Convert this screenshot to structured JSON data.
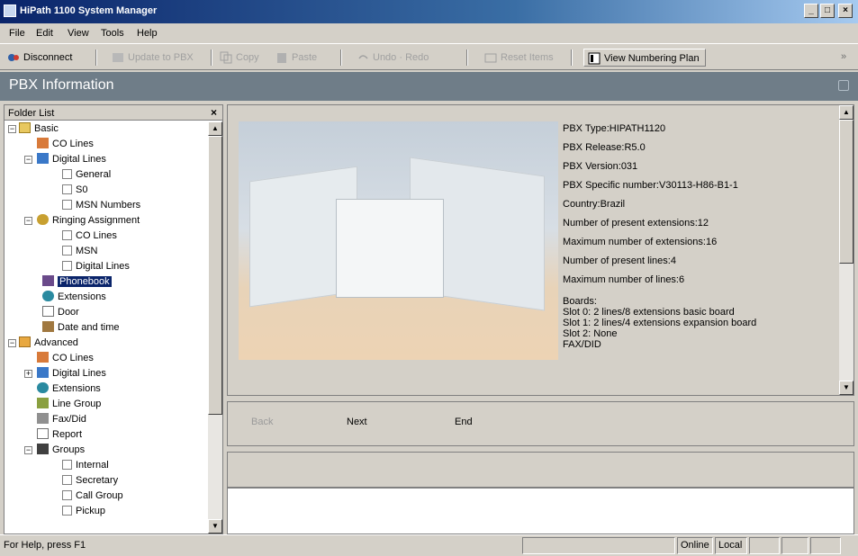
{
  "window": {
    "title": "HiPath 1100 System Manager",
    "controls": [
      "_",
      "□",
      "×"
    ]
  },
  "menu": [
    "File",
    "Edit",
    "View",
    "Tools",
    "Help"
  ],
  "toolbar": {
    "disconnect": "Disconnect",
    "update": "Update to PBX",
    "copy": "Copy",
    "paste": "Paste",
    "undo_redo": "Undo · Redo",
    "reset": "Reset Items",
    "numbering_plan": "View Numbering Plan",
    "overflow": "»"
  },
  "page_header": "PBX Information",
  "folder_list": {
    "header": "Folder List",
    "close": "×",
    "items": [
      {
        "label": "Basic",
        "kind": "folder"
      },
      {
        "label": "CO Lines",
        "kind": "item"
      },
      {
        "label": "Digital Lines",
        "kind": "item"
      },
      {
        "label": "General",
        "kind": "check"
      },
      {
        "label": "S0",
        "kind": "check"
      },
      {
        "label": "MSN Numbers",
        "kind": "check"
      },
      {
        "label": "Ringing Assignment",
        "kind": "item"
      },
      {
        "label": "CO Lines",
        "kind": "check"
      },
      {
        "label": "MSN",
        "kind": "check"
      },
      {
        "label": "Digital Lines",
        "kind": "check"
      },
      {
        "label": "Phonebook",
        "kind": "item",
        "selected": true
      },
      {
        "label": "Extensions",
        "kind": "item"
      },
      {
        "label": "Door",
        "kind": "item"
      },
      {
        "label": "Date and time",
        "kind": "item"
      },
      {
        "label": "Advanced",
        "kind": "folder"
      },
      {
        "label": "CO Lines",
        "kind": "item"
      },
      {
        "label": "Digital Lines",
        "kind": "item"
      },
      {
        "label": "Extensions",
        "kind": "item"
      },
      {
        "label": "Line Group",
        "kind": "item"
      },
      {
        "label": "Fax/Did",
        "kind": "item"
      },
      {
        "label": "Report",
        "kind": "item"
      },
      {
        "label": "Groups",
        "kind": "item"
      },
      {
        "label": "Internal",
        "kind": "check"
      },
      {
        "label": "Secretary",
        "kind": "check"
      },
      {
        "label": "Call Group",
        "kind": "check"
      },
      {
        "label": "Pickup",
        "kind": "check"
      }
    ]
  },
  "pbx_info": {
    "pbx_type": "PBX Type:HIPATH1120",
    "release": "PBX Release:R5.0",
    "version": "PBX Version:031",
    "specific_number": "PBX Specific number:V30113-H86-B1-1",
    "country": "Country:Brazil",
    "present_extensions": "Number of present extensions:12",
    "max_extensions": "Maximum number of extensions:16",
    "present_lines": "Number of present lines:4",
    "max_lines": "Maximum number of lines:6",
    "boards_title": "Boards:",
    "slot0": "Slot 0: 2 lines/8 extensions basic board",
    "slot1": "Slot 1: 2 lines/4 extensions expansion board",
    "slot2": "Slot 2: None",
    "fax": "FAX/DID"
  },
  "nav": {
    "back": "Back",
    "next": "Next",
    "end": "End"
  },
  "status": {
    "help": "For Help, press F1",
    "online": "Online",
    "local": "Local"
  },
  "colors": {
    "title_gradient_start": "#0a246a",
    "header_band": "#6f7d88",
    "selection": "#0a246a"
  }
}
